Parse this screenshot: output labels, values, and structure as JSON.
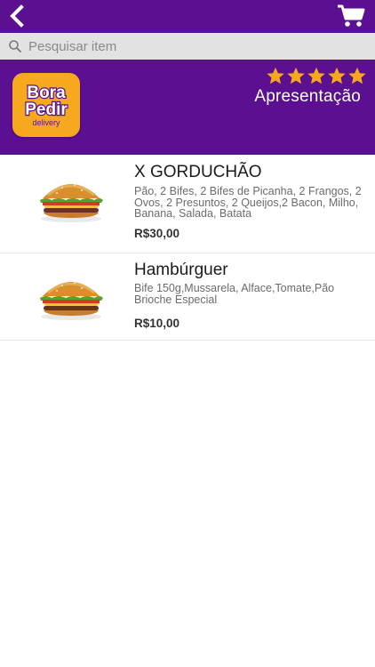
{
  "colors": {
    "brand_purple": "#5b0f91",
    "logo_orange": "#f6a81f",
    "star_orange": "#f6a81f",
    "search_bg": "#e2e2e2"
  },
  "toolbar": {
    "back_icon": "chevron-left-icon",
    "cart_icon": "shopping-cart-icon"
  },
  "search": {
    "placeholder": "Pesquisar item",
    "value": ""
  },
  "store": {
    "name": "Apresentação",
    "rating": 5,
    "rating_max": 5,
    "logo": {
      "line1": "Bora",
      "line2": "Pedir",
      "line3": "delivery"
    }
  },
  "menu": {
    "items": [
      {
        "name": "X GORDUCHÃO",
        "description": "Pão, 2 Bifes, 2 Bifes de Picanha, 2 Frangos, 2 Ovos, 2 Presuntos, 2 Queijos,2 Bacon, Milho, Banana, Salada, Batata",
        "price": "R$30,00",
        "image_icon": "burger-image"
      },
      {
        "name": "Hambúrguer",
        "description": "Bife 150g,Mussarela, Alface,Tomate,Pão Brioche Especial",
        "price": "R$10,00",
        "image_icon": "burger-image"
      }
    ]
  }
}
